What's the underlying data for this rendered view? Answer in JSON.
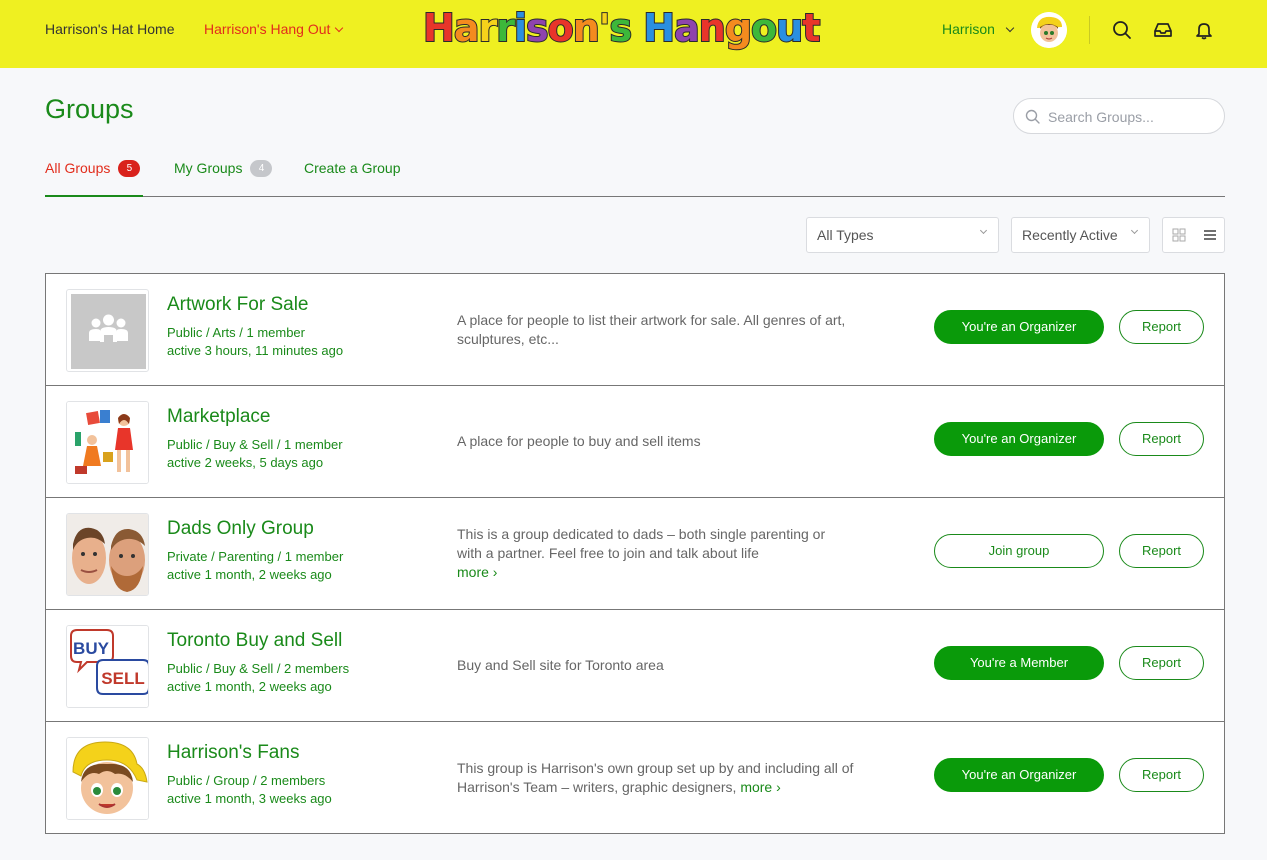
{
  "header": {
    "home_link": "Harrison's Hat Home",
    "hangout_menu": "Harrison's Hang Out",
    "logo_text": "Harrison's Hangout",
    "user_name": "Harrison",
    "icons": [
      "search-icon",
      "inbox-icon",
      "bell-icon"
    ]
  },
  "page": {
    "title": "Groups",
    "search_placeholder": "Search Groups..."
  },
  "tabs": [
    {
      "label": "All Groups",
      "count": "5",
      "active": true
    },
    {
      "label": "My Groups",
      "count": "4",
      "active": false
    },
    {
      "label": "Create a Group",
      "count": "",
      "active": false
    }
  ],
  "filters": {
    "type": "All Types",
    "order": "Recently Active"
  },
  "groups": [
    {
      "name": "Artwork For Sale",
      "meta": "Public / Arts / 1 member",
      "active": "active 3 hours, 11 minutes ago",
      "desc": "A place for people to list their artwork for sale. All genres of art, sculptures, etc...",
      "more": "",
      "action": "You're an Organizer",
      "report": "Report"
    },
    {
      "name": "Marketplace",
      "meta": "Public / Buy & Sell / 1 member",
      "active": "active 2 weeks, 5 days ago",
      "desc": "A place for people to buy and sell items",
      "more": "",
      "action": "You're an Organizer",
      "report": "Report"
    },
    {
      "name": "Dads Only Group",
      "meta": "Private / Parenting / 1 member",
      "active": "active 1 month, 2 weeks ago",
      "desc": "This is a group dedicated to dads – both single parenting or with a partner. Feel free to join and talk about life",
      "more": "more ›",
      "action": "Join group",
      "report": "Report"
    },
    {
      "name": "Toronto Buy and Sell",
      "meta": "Public / Buy & Sell / 2 members",
      "active": "active 1 month, 2 weeks ago",
      "desc": "Buy and Sell site for Toronto area",
      "more": "",
      "action": "You're a Member",
      "report": "Report"
    },
    {
      "name": "Harrison's Fans",
      "meta": "Public / Group / 2 members",
      "active": "active 1 month, 3 weeks ago",
      "desc": "This group is Harrison's own group set up by and including all of Harrison's Team – writers, graphic designers,",
      "more": "more ›",
      "action": "You're an Organizer",
      "report": "Report"
    }
  ],
  "thumb_labels": {
    "toronto_top": "BUY",
    "toronto_bottom": "SELL"
  },
  "colors": {
    "header_bg": "#eff021",
    "accent_green": "#1a8a1a",
    "button_green": "#0a9a0a",
    "active_red": "#e22d1c"
  }
}
